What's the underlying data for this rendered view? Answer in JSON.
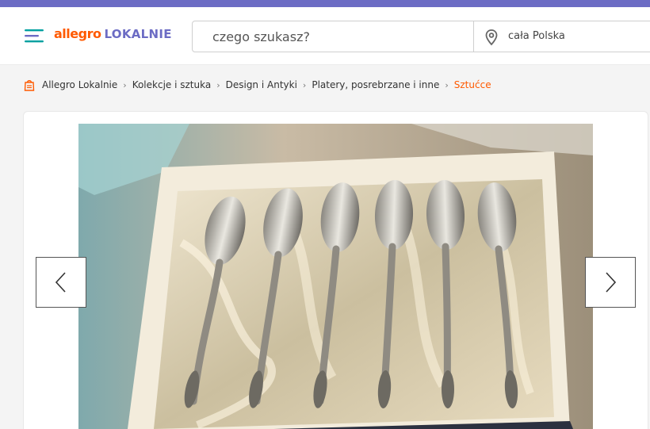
{
  "header": {
    "logo_brand": "allegro",
    "logo_suffix": "LOKALNIE",
    "menu_icon": "hamburger-icon",
    "search_placeholder": "czego szukasz?",
    "location_icon": "map-pin-icon",
    "location_value": "cała Polska"
  },
  "breadcrumb": {
    "home_icon": "bag-icon",
    "items": [
      "Allegro Lokalnie",
      "Kolekcje i sztuka",
      "Design i Antyki",
      "Platery, posrebrzane i inne"
    ],
    "current": "Sztućce"
  },
  "gallery": {
    "image_subject": "silver-plated teaspoons in box",
    "prev_icon": "chevron-left-icon",
    "next_icon": "chevron-right-icon"
  },
  "colors": {
    "brand_orange": "#ff5a00",
    "brand_purple": "#6c6cc4",
    "menu_teal": "#00a0a0"
  }
}
